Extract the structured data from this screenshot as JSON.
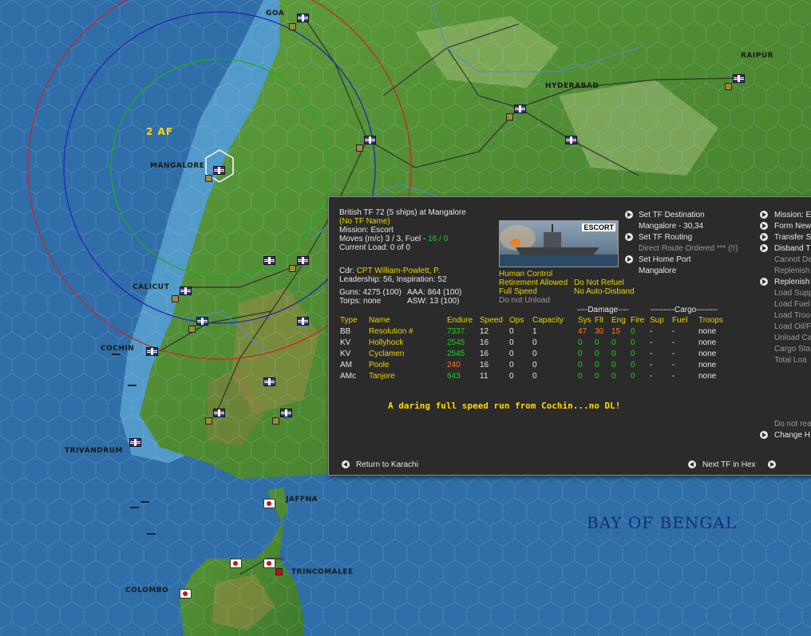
{
  "map": {
    "cities": {
      "goa": "GOA",
      "raipur": "RAIPUR",
      "hyderabad": "HYDERABAD",
      "mangalore": "MANGALORE",
      "calicut": "CALICUT",
      "cochin": "COCHIN",
      "trivandrum": "TRIVANDRUM",
      "jaffna": "JAFFNA",
      "trincomalee": "TRINCOMALEE",
      "colombo": "COLOMBO"
    },
    "air_unit_label": "2 AF",
    "sea_label": "BAY OF BENGAL"
  },
  "panel": {
    "header": {
      "title": "British TF 72 (5 ships) at Mangalore",
      "tf_name": "(No TF Name)",
      "mission": "Mission: Escort",
      "moves_prefix": "Moves (m/c)  3 / 3, Fuel - ",
      "fuel_value": "16 / 0",
      "current_load": "Current Load:  0 of 0"
    },
    "commander": {
      "cdr_label": "Cdr:",
      "cdr_name": "CPT William-Powlett, P.",
      "leadership": "Leadership: 56, Inspiration: 52"
    },
    "stats": {
      "guns": "Guns: 4275 (100)",
      "aaa": "AAA: 864 (100)",
      "torps": "Torps: none",
      "asw": "ASW: 13 (100)"
    },
    "ship_image_label": "ESCORT",
    "control": {
      "human_control": "Human Control",
      "retirement": "Retirement Allowed",
      "do_not_refuel": "Do Not Refuel",
      "full_speed": "Full Speed",
      "no_auto_disband": "No Auto-Disband",
      "do_not_unload": "Do not Unload"
    },
    "middle_menu": {
      "set_destination": "Set TF Destination",
      "destination_value": "Mangalore - 30,34",
      "set_routing": "Set TF Routing",
      "direct_route": "Direct Route Ordered *** (!!)",
      "set_home_port": "Set Home Port",
      "home_port_value": "Mangalore"
    },
    "right_menu": {
      "mission": "Mission: Es",
      "form_new": "Form New",
      "transfer": "Transfer S",
      "disband": "Disband T",
      "cannot": "Cannot De",
      "replenish_gray": "Replenish",
      "replenish": "Replenish",
      "load_supp": "Load Supp",
      "load_fuel": "Load Fuel",
      "load_troo": "Load Troo",
      "load_oil": "Load Oil/F",
      "unload_ca": "Unload Ca",
      "cargo_sta": "Cargo Sta",
      "total_loa": "Total Loa",
      "do_not_rea": "Do not rea",
      "change_h": "Change H"
    },
    "table": {
      "damage_header": "----Damage----",
      "cargo_header": "---------Cargo--------",
      "columns": [
        "Type",
        "Name",
        "Endure",
        "Speed",
        "Ops",
        "Capacity",
        "Sys",
        "Flt",
        "Eng",
        "Fire",
        "Sup",
        "Fuel",
        "Troops"
      ],
      "rows": [
        [
          "BB",
          "Resolution #",
          "7337",
          "12",
          "0",
          "1",
          "47",
          "30",
          "15",
          "0",
          "-",
          "-",
          "none"
        ],
        [
          "KV",
          "Hollyhock",
          "2545",
          "16",
          "0",
          "0",
          "0",
          "0",
          "0",
          "0",
          "-",
          "-",
          "none"
        ],
        [
          "KV",
          "Cyclamen",
          "2545",
          "16",
          "0",
          "0",
          "0",
          "0",
          "0",
          "0",
          "-",
          "-",
          "none"
        ],
        [
          "AM",
          "Poole",
          "240",
          "16",
          "0",
          "0",
          "0",
          "0",
          "0",
          "0",
          "-",
          "-",
          "none"
        ],
        [
          "AMc",
          "Tanjore",
          "643",
          "11",
          "0",
          "0",
          "0",
          "0",
          "0",
          "0",
          "-",
          "-",
          "none"
        ]
      ]
    },
    "message": "A daring full speed run from Cochin...no DL!",
    "footer": {
      "return": "Return to Karachi",
      "next_tf": "Next TF in Hex"
    }
  }
}
